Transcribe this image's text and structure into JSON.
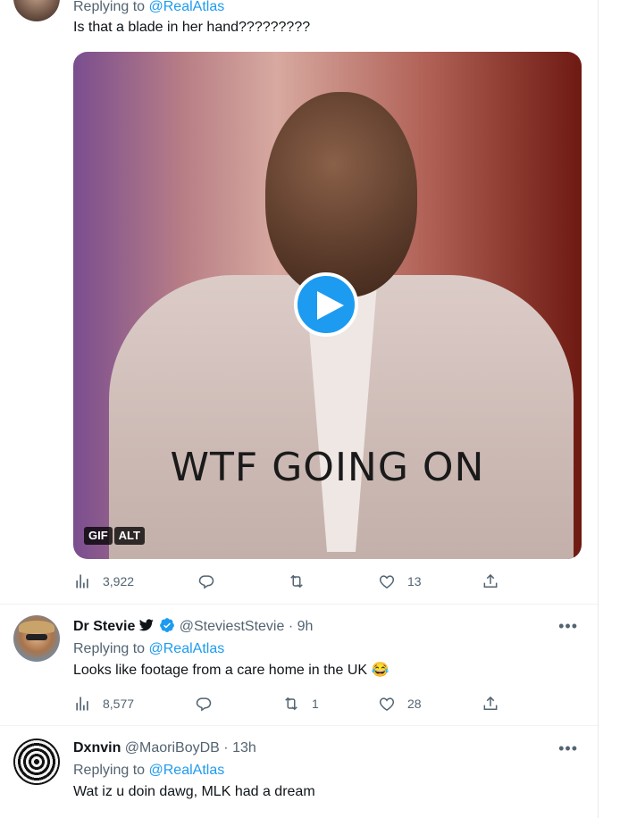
{
  "tweets": [
    {
      "reply_prefix": "Replying to",
      "reply_to": "@RealAtlas",
      "text": "Is that a blade in her hand?????????",
      "media": {
        "caption": "WTF GOING ON",
        "badges": [
          "GIF",
          "ALT"
        ]
      },
      "actions": {
        "views": "3,922",
        "replies": "",
        "retweets": "",
        "likes": "13"
      }
    },
    {
      "display_name": "Dr Stevie",
      "name_emoji": "🐦",
      "handle": "@SteviestStevie",
      "separator": "·",
      "time": "9h",
      "reply_prefix": "Replying to",
      "reply_to": "@RealAtlas",
      "text": "Looks like footage from a care home in the UK 😂",
      "actions": {
        "views": "8,577",
        "replies": "",
        "retweets": "1",
        "likes": "28"
      }
    },
    {
      "display_name": "Dxnvin",
      "handle": "@MaoriBoyDB",
      "separator": "·",
      "time": "13h",
      "reply_prefix": "Replying to",
      "reply_to": "@RealAtlas",
      "text": "Wat iz u doin dawg, MLK had a dream"
    }
  ],
  "more_label": "•••",
  "colors": {
    "accent": "#1d9bf0",
    "secondary_text": "#536471",
    "primary_text": "#0f1419"
  },
  "icons": [
    "analytics-icon",
    "reply-icon",
    "retweet-icon",
    "like-icon",
    "share-icon",
    "verified-icon",
    "play-icon",
    "more-icon"
  ]
}
